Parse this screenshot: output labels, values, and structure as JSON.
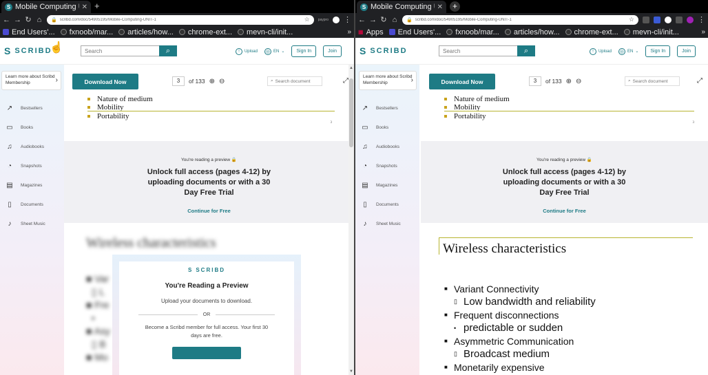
{
  "browser": {
    "tab_title": "Mobile Computing U",
    "tab_title_right": "Mobile Computing U",
    "url": "scribd.com/doc/54905195/Mobile-Computing-UNIT-1",
    "ext_label": "paypro",
    "bookmarks": [
      "End Users'...",
      "fxnoob/mar...",
      "articles/how...",
      "chrome-ext...",
      "mevn-cli/init..."
    ],
    "bookmarks_right": [
      "Apps",
      "End Users'...",
      "fxnoob/mar...",
      "articles/how...",
      "chrome-ext...",
      "mevn-cli/init..."
    ]
  },
  "header": {
    "logo": "SCRIBD",
    "search_placeholder": "Search",
    "upload": "Upload",
    "language": "EN",
    "sign_in": "Sign In",
    "join": "Join"
  },
  "sidebar": {
    "membership": "Learn more about Scribd Membership",
    "items": [
      "Bestsellers",
      "Books",
      "Audiobooks",
      "Snapshots",
      "Magazines",
      "Documents",
      "Sheet Music"
    ]
  },
  "docbar": {
    "download": "Download Now",
    "page": "3",
    "of_total": "of 133",
    "search_doc": "Search document"
  },
  "page1": {
    "bullets": [
      "Nature of medium",
      "Mobility",
      "Portability"
    ],
    "page_number": "3"
  },
  "preview": {
    "reading": "You're reading a preview",
    "title": "Unlock full access (pages 4-12) by uploading documents or with a 30 Day Free Trial",
    "continue": "Continue for Free"
  },
  "modal": {
    "logo": "SCRIBD",
    "title": "You're Reading a Preview",
    "upload_text": "Upload your documents to download.",
    "or": "OR",
    "member_text": "Become a Scribd member for full access. Your first 30 days are free."
  },
  "page2": {
    "title": "Wireless characteristics",
    "items": [
      {
        "marker": "■",
        "text": "Variant Connectivity",
        "sub": false
      },
      {
        "marker": "▯",
        "text": "Low bandwidth and reliability",
        "sub": true
      },
      {
        "marker": "■",
        "text": "Frequent disconnections",
        "sub": false
      },
      {
        "marker": "•",
        "text": "predictable or sudden",
        "sub": true
      },
      {
        "marker": "■",
        "text": "Asymmetric Communication",
        "sub": false
      },
      {
        "marker": "▯",
        "text": "Broadcast medium",
        "sub": true
      },
      {
        "marker": "■",
        "text": "Monetarily expensive",
        "sub": false
      }
    ]
  }
}
